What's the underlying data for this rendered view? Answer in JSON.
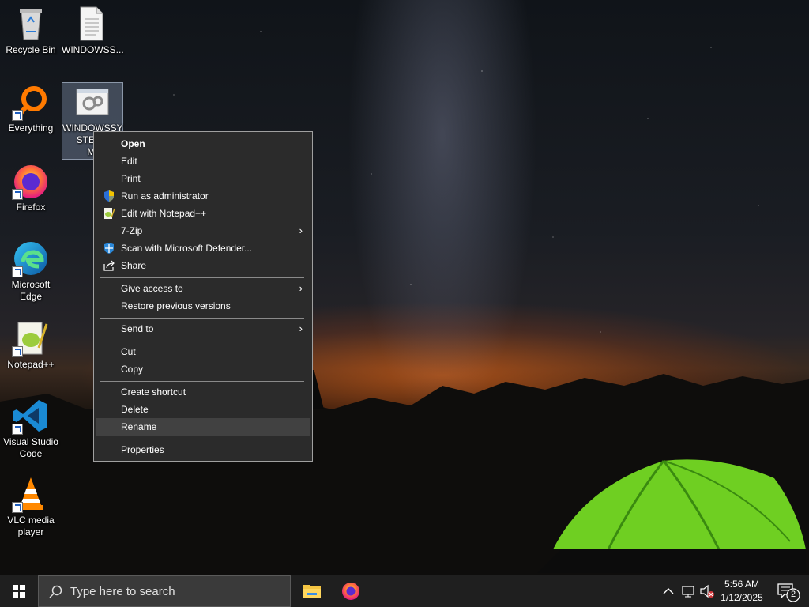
{
  "desktop_icons": [
    {
      "label": "Recycle Bin",
      "icon": "recycle-bin-icon"
    },
    {
      "label": "WINDOWSS...",
      "icon": "text-document-icon"
    },
    {
      "label": "Everything",
      "icon": "everything-search-icon"
    },
    {
      "label": "WINDOWSSY STEMF... MI",
      "line1": "WINDOWSSY",
      "line2": "STEMF",
      "line3": "MI",
      "icon": "system-file-icon"
    },
    {
      "label": "Firefox",
      "icon": "firefox-icon"
    },
    {
      "label": "Microsoft Edge",
      "line1": "Microsoft",
      "line2": "Edge",
      "icon": "edge-icon"
    },
    {
      "label": "Notepad++",
      "icon": "notepadpp-icon"
    },
    {
      "label": "Visual Studio Code",
      "line1": "Visual Studio",
      "line2": "Code",
      "icon": "vscode-icon"
    },
    {
      "label": "VLC media player",
      "line1": "VLC media",
      "line2": "player",
      "icon": "vlc-icon"
    }
  ],
  "context_menu": {
    "items": [
      {
        "label": "Open"
      },
      {
        "label": "Edit"
      },
      {
        "label": "Print"
      },
      {
        "label": "Run as administrator",
        "icon": "uac-shield-icon"
      },
      {
        "label": "Edit with Notepad++",
        "icon": "notepadpp-icon"
      },
      {
        "label": "7-Zip",
        "submenu": true
      },
      {
        "label": "Scan with Microsoft Defender...",
        "icon": "defender-icon"
      },
      {
        "label": "Share",
        "icon": "share-icon"
      },
      {
        "label": "Give access to",
        "submenu": true
      },
      {
        "label": "Restore previous versions"
      },
      {
        "label": "Send to",
        "submenu": true
      },
      {
        "label": "Cut"
      },
      {
        "label": "Copy"
      },
      {
        "label": "Create shortcut"
      },
      {
        "label": "Delete"
      },
      {
        "label": "Rename",
        "highlighted": true
      },
      {
        "label": "Properties"
      }
    ],
    "arrow_glyph": "›"
  },
  "taskbar": {
    "search_placeholder": "Type here to search",
    "pinned": [
      "file-explorer-icon",
      "firefox-icon"
    ],
    "clock_time": "5:56 AM",
    "clock_date": "1/12/2025",
    "notification_count": "2"
  },
  "colors": {
    "taskbar_bg": "#1f1f1f",
    "menu_bg": "#2b2b2b",
    "menu_highlight": "#414141",
    "tent_green": "#7cdc2a",
    "horizon_orange": "#ff7a1a"
  }
}
